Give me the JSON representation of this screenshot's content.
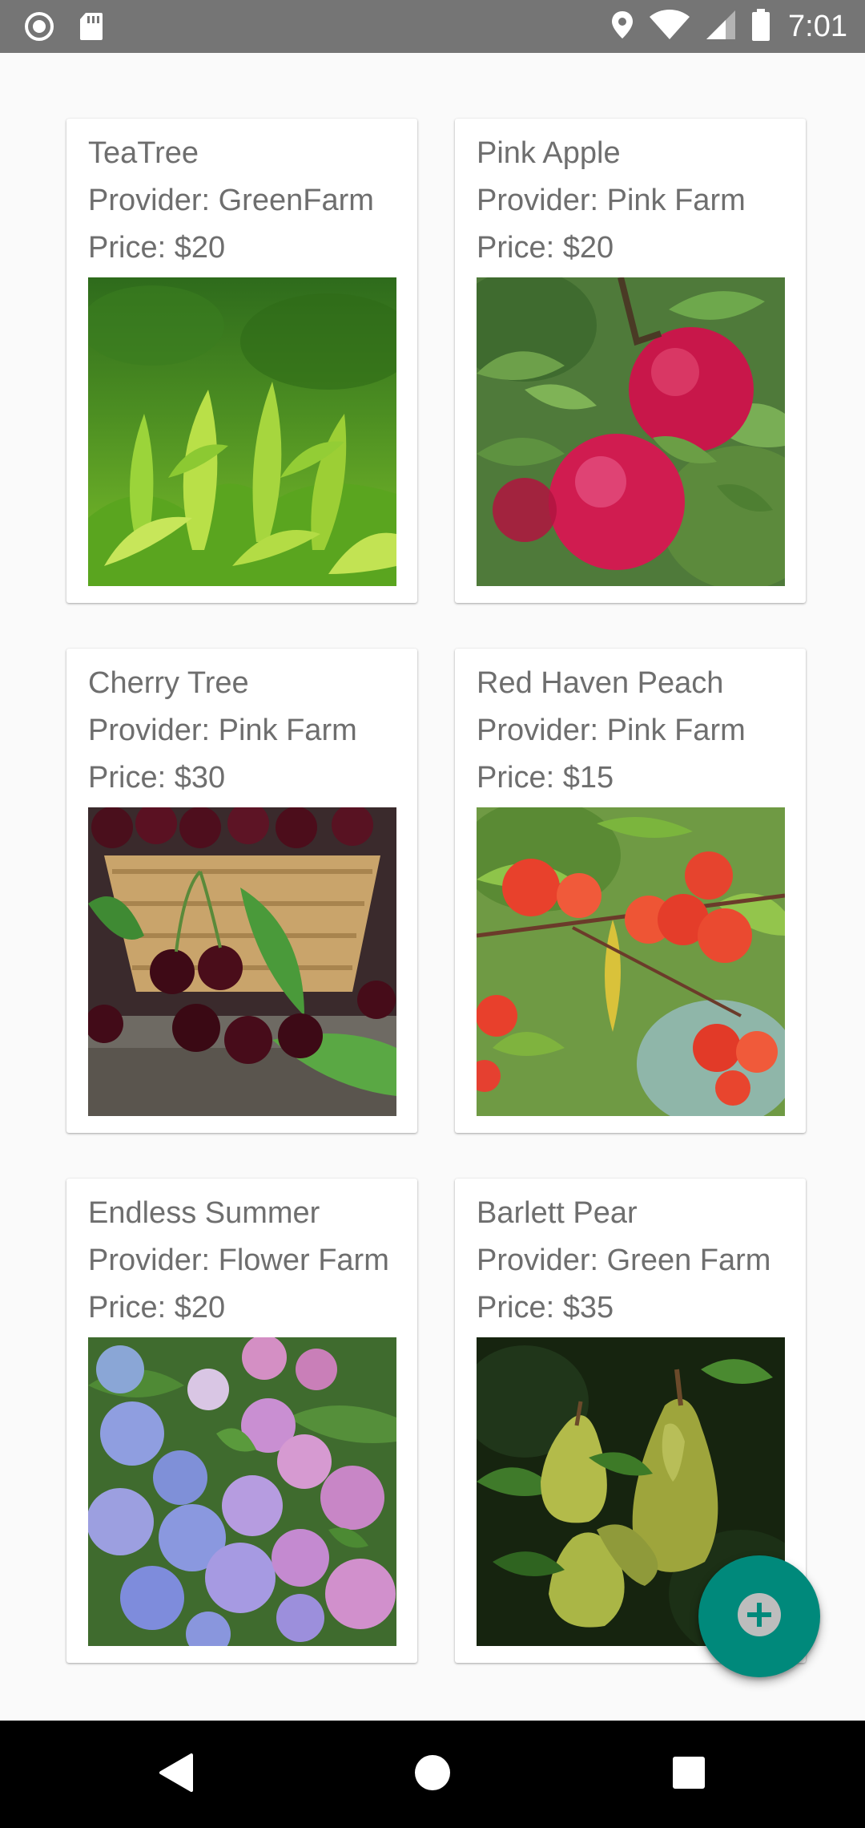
{
  "status_bar": {
    "time": "7:01",
    "icons": [
      "record-icon",
      "sd-card-icon",
      "location-icon",
      "wifi-icon",
      "signal-icon",
      "battery-icon"
    ]
  },
  "products": [
    {
      "name": "TeaTree",
      "provider": "Provider: GreenFarm",
      "price": "Price: $20",
      "image": "tea-leaves-photo"
    },
    {
      "name": "Pink Apple",
      "provider": "Provider: Pink Farm",
      "price": "Price: $20",
      "image": "pink-apple-photo"
    },
    {
      "name": "Cherry Tree",
      "provider": "Provider: Pink Farm",
      "price": "Price: $30",
      "image": "cherry-basket-photo"
    },
    {
      "name": "Red Haven Peach",
      "provider": "Provider: Pink Farm",
      "price": "Price: $15",
      "image": "peach-tree-photo"
    },
    {
      "name": "Endless Summer",
      "provider": "Provider: Flower Farm",
      "price": "Price: $20",
      "image": "hydrangea-photo"
    },
    {
      "name": "Barlett Pear",
      "provider": "Provider: Green Farm",
      "price": "Price: $35",
      "image": "pear-photo"
    }
  ],
  "fab": {
    "icon": "add-circle-icon",
    "color": "#00897b"
  },
  "nav": {
    "icons": [
      "back-icon",
      "home-icon",
      "recents-icon"
    ]
  },
  "colors": {
    "status_bar": "#757575",
    "background": "#fafafa",
    "text": "#6e6e6e",
    "accent": "#00897b"
  }
}
